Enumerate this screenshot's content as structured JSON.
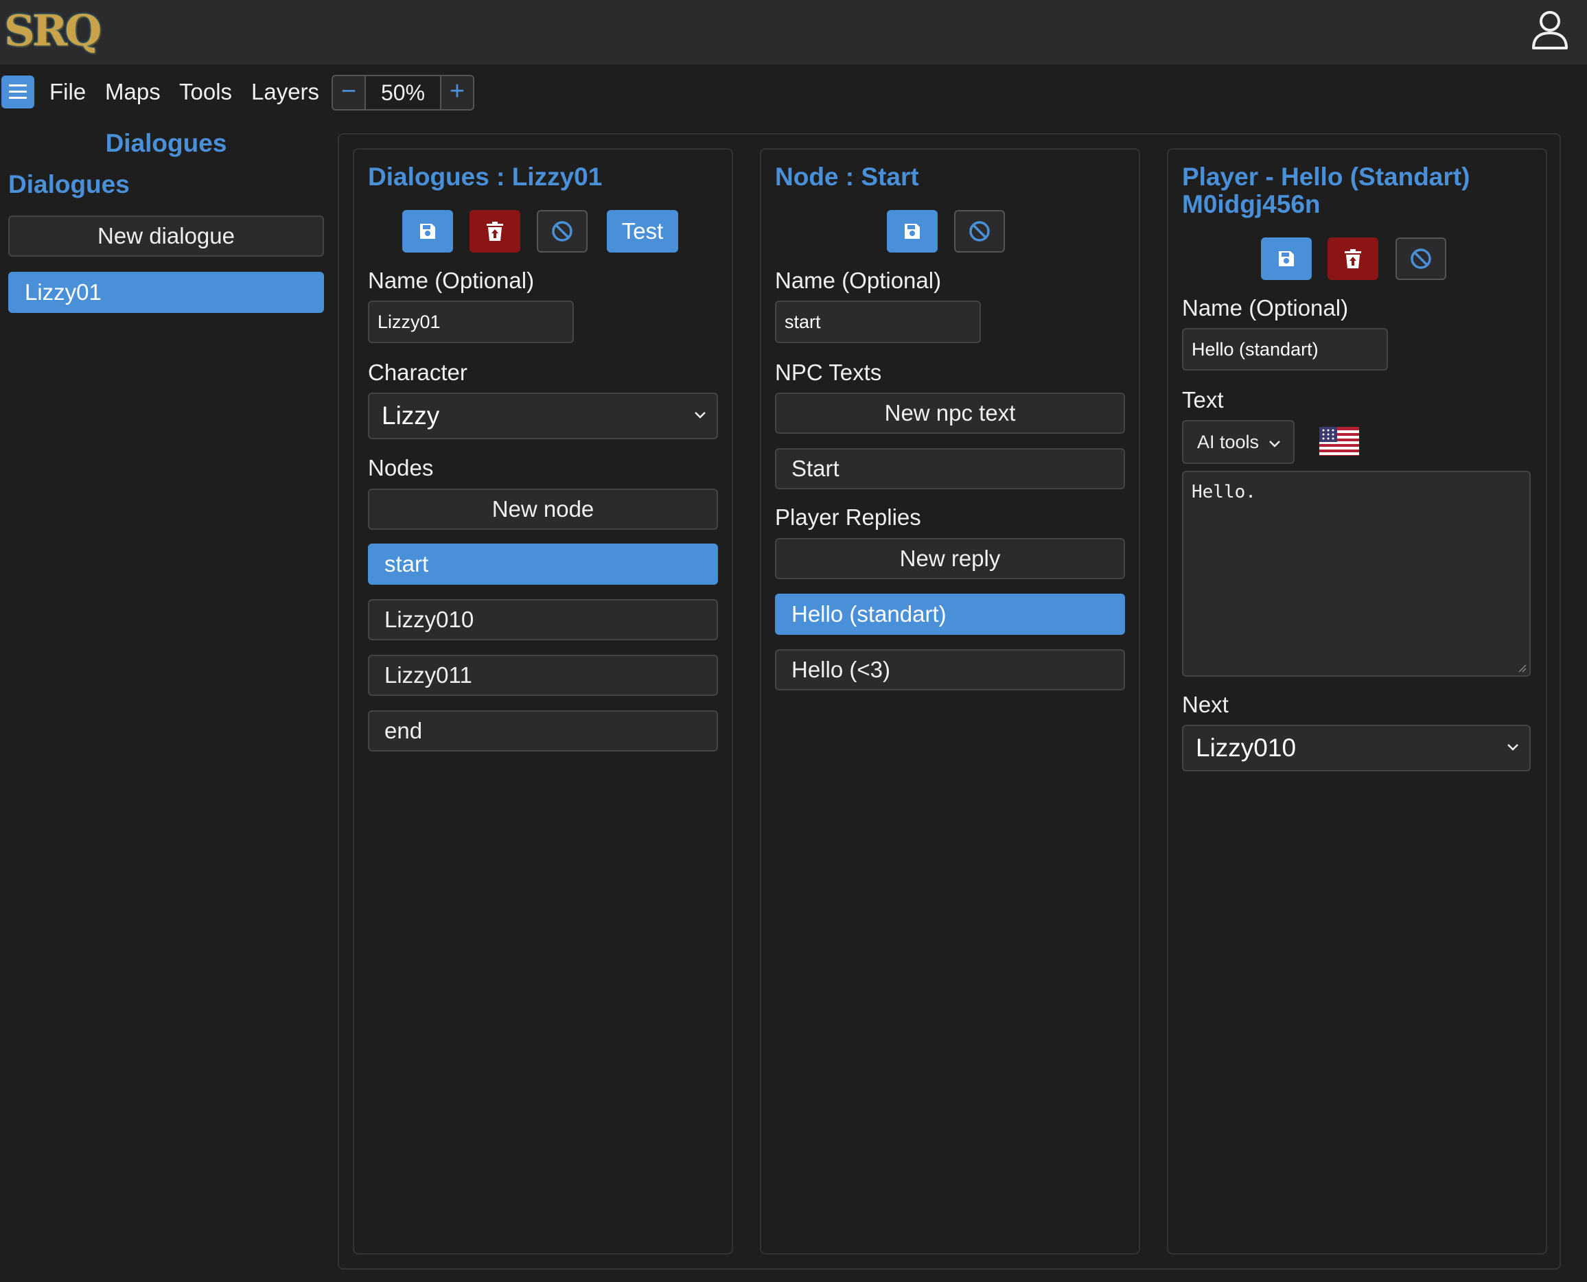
{
  "app": {
    "logo_text": "SRQ"
  },
  "menu": {
    "items": [
      "File",
      "Maps",
      "Tools",
      "Layers"
    ],
    "zoom": {
      "minus": "−",
      "value": "50%",
      "plus": "+"
    }
  },
  "sidebar": {
    "title": "Dialogues",
    "subtitle": "Dialogues",
    "new_button": "New dialogue",
    "items": [
      {
        "label": "Lizzy01",
        "selected": true
      }
    ]
  },
  "dialogue_panel": {
    "title": "Dialogues : Lizzy01",
    "test_label": "Test",
    "name_label": "Name (Optional)",
    "name_value": "Lizzy01",
    "character_label": "Character",
    "character_value": "Lizzy",
    "nodes_label": "Nodes",
    "new_node_label": "New node",
    "nodes": [
      {
        "label": "start",
        "selected": true
      },
      {
        "label": "Lizzy010",
        "selected": false
      },
      {
        "label": "Lizzy011",
        "selected": false
      },
      {
        "label": "end",
        "selected": false
      }
    ]
  },
  "node_panel": {
    "title": "Node : Start",
    "name_label": "Name (Optional)",
    "name_value": "start",
    "npc_texts_label": "NPC Texts",
    "new_npc_text_label": "New npc text",
    "npc_texts": [
      {
        "label": "Start",
        "selected": false
      }
    ],
    "replies_label": "Player Replies",
    "new_reply_label": "New reply",
    "replies": [
      {
        "label": "Hello (standart)",
        "selected": true
      },
      {
        "label": "Hello (<3)",
        "selected": false
      }
    ]
  },
  "reply_panel": {
    "title_line1": "Player - Hello (Standart)",
    "title_line2": "M0idgj456n",
    "name_label": "Name (Optional)",
    "name_value": "Hello (standart)",
    "text_label": "Text",
    "ai_tools_label": "AI tools",
    "language_icon": "us-flag-icon",
    "text_value": "Hello.",
    "next_label": "Next",
    "next_value": "Lizzy010"
  },
  "colors": {
    "accent": "#4a90d9",
    "danger": "#8b1515",
    "background": "#1e1e1e",
    "surface": "#2b2b2e"
  }
}
